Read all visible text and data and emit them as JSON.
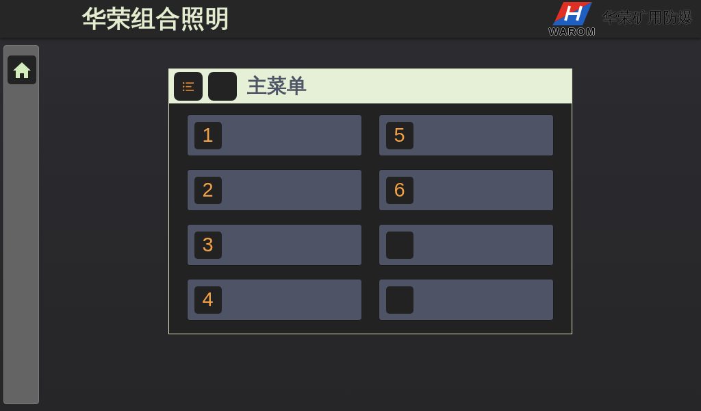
{
  "header": {
    "title": "华荣组合照明",
    "brand": {
      "logo_text": "WAROM",
      "name": "华荣矿用防爆"
    }
  },
  "panel": {
    "title": "主菜单",
    "menu_items": [
      {
        "kind": "numbered",
        "number": "1"
      },
      {
        "kind": "numbered",
        "number": "2"
      },
      {
        "kind": "numbered",
        "number": "3"
      },
      {
        "kind": "numbered",
        "number": "4"
      },
      {
        "kind": "numbered",
        "number": "5"
      },
      {
        "kind": "numbered",
        "number": "6"
      },
      {
        "kind": "blank"
      },
      {
        "kind": "blank"
      }
    ]
  }
}
